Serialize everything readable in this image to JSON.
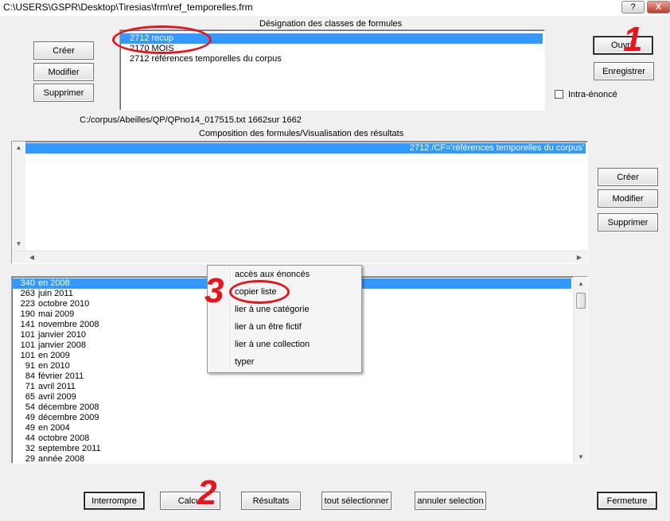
{
  "window": {
    "title": "C:\\USERS\\GSPR\\Desktop\\Tiresias\\frm\\ref_temporelles.frm",
    "help_label": "?",
    "close_label": "X"
  },
  "classes": {
    "header": "Désignation des classes de formules",
    "items": [
      "2712  recup",
      "2170  MOIS",
      "2712  références temporelles du corpus"
    ],
    "buttons": {
      "create": "Créer",
      "modify": "Modifier",
      "delete": "Supprimer"
    }
  },
  "right_buttons": {
    "open": "Ouvrir",
    "save": "Enregistrer",
    "intra_label": "Intra-énoncé"
  },
  "path_text": "C:/corpus/Abeilles/QP/QPno14_017515.txt 1662sur 1662",
  "composition": {
    "header": "Composition des formules/Visualisation des résultats",
    "selected_row": "2712  /CF='références temporelles du corpus'",
    "buttons": {
      "create": "Créer",
      "modify": "Modifier",
      "delete": "Supprimer"
    }
  },
  "results": [
    {
      "count": "340",
      "label": "en 2008"
    },
    {
      "count": "263",
      "label": "juin 2011"
    },
    {
      "count": "223",
      "label": "octobre 2010"
    },
    {
      "count": "190",
      "label": "mai 2009"
    },
    {
      "count": "141",
      "label": "novembre 2008"
    },
    {
      "count": "101",
      "label": "janvier 2010"
    },
    {
      "count": "101",
      "label": "janvier 2008"
    },
    {
      "count": "101",
      "label": "en 2009"
    },
    {
      "count": "91",
      "label": "en 2010"
    },
    {
      "count": "84",
      "label": "février 2011"
    },
    {
      "count": "71",
      "label": "avril 2011"
    },
    {
      "count": "65",
      "label": "avril 2009"
    },
    {
      "count": "54",
      "label": "décembre 2008"
    },
    {
      "count": "49",
      "label": "décembre 2009"
    },
    {
      "count": "49",
      "label": "en 2004"
    },
    {
      "count": "44",
      "label": "octobre 2008"
    },
    {
      "count": "32",
      "label": "septembre 2011"
    },
    {
      "count": "29",
      "label": "année 2008"
    }
  ],
  "context_menu": [
    "accès aux énoncés",
    "copier liste",
    "lier à une catégorie",
    "lier à un être fictif",
    "lier à une collection",
    "typer"
  ],
  "bottom_buttons": {
    "interrupt": "Interrompre",
    "compute": "Calcul",
    "results": "Résultats",
    "select_all": "tout sélectionner",
    "cancel_selection": "annuler selection",
    "close": "Fermeture"
  },
  "annotations": {
    "one": "1",
    "two": "2",
    "three": "3",
    "color": "#e8131b"
  }
}
